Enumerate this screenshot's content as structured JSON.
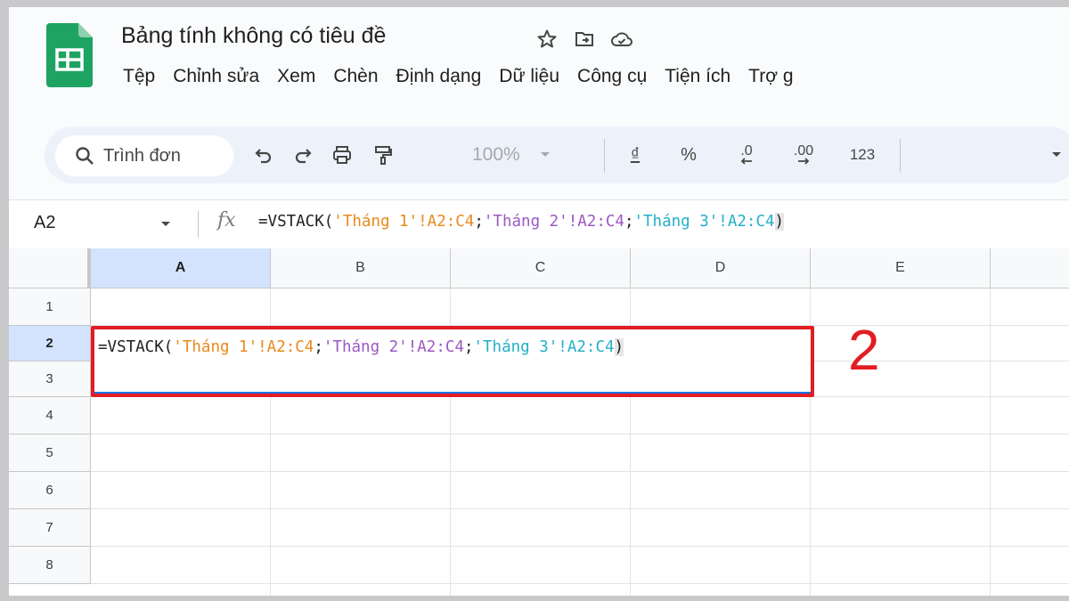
{
  "document": {
    "title": "Bảng tính không có tiêu đề"
  },
  "menu": [
    "Tệp",
    "Chỉnh sửa",
    "Xem",
    "Chèn",
    "Định dạng",
    "Dữ liệu",
    "Công cụ",
    "Tiện ích",
    "Trợ g"
  ],
  "toolbar": {
    "search_text": "Trình đơn",
    "zoom": "100%",
    "currency": "₫",
    "percent": "%",
    "decrease_decimal": ".0",
    "increase_decimal": ".00",
    "number_format": "123"
  },
  "formula_bar": {
    "cell_ref": "A2",
    "fx": "fx",
    "prefix": "=VSTACK(",
    "ref1": "'Tháng 1'!A2:C4",
    "sep1": ";",
    "ref2": "'Tháng 2'!A2:C4",
    "sep2": ";",
    "ref3": "'Tháng 3'!A2:C4",
    "suffix": ")"
  },
  "grid": {
    "columns": [
      "A",
      "B",
      "C",
      "D",
      "E"
    ],
    "rows": [
      "1",
      "2",
      "3",
      "4",
      "5",
      "6",
      "7",
      "8"
    ],
    "active_column": "A",
    "active_row": "2"
  },
  "annotation": {
    "step": "2",
    "color": "#e11d24"
  },
  "colors": {
    "ref1": "#e88a1a",
    "ref2": "#9c58c2",
    "ref3": "#24b0c8",
    "brand": "#1e8e3e"
  }
}
